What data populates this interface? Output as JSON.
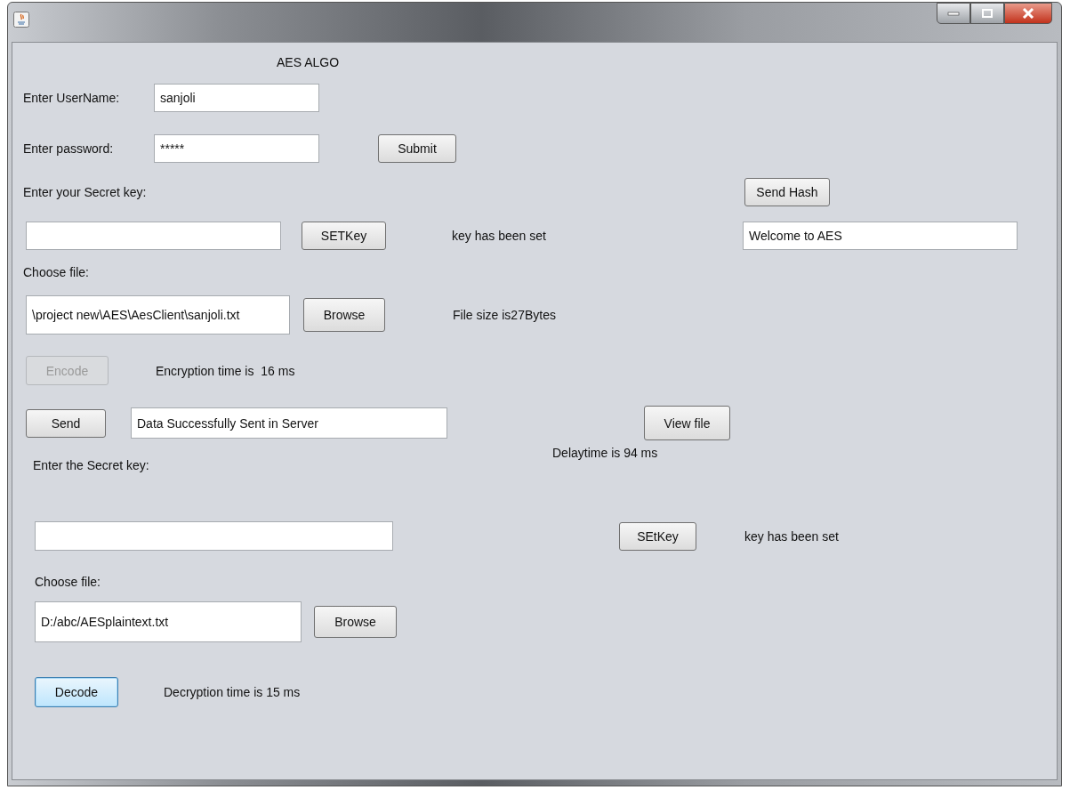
{
  "heading": "AES ALGO",
  "login": {
    "username_label": "Enter UserName:",
    "username": "sanjoli",
    "password_label": "Enter password:",
    "password": "*****",
    "submit_button": "Submit"
  },
  "encrypt": {
    "secret_key_label": "Enter your Secret key:",
    "send_hash_button": "Send Hash",
    "set_key_button": "SETKey",
    "key_status": "key has been set",
    "hash_message": "Welcome to AES",
    "choose_file_label": "Choose file:",
    "file_path": "\\project new\\AES\\AesClient\\sanjoli.txt",
    "browse_button": "Browse",
    "file_size": "File size is27Bytes",
    "encode_button": {
      "label": "Encode",
      "disabled": true
    },
    "encryption_time": "Encryption time is  16 ms",
    "send_button": "Send",
    "send_status": "Data Successfully Sent in Server",
    "view_file_button": "View file",
    "delay_time": "Delaytime is 94 ms"
  },
  "decrypt": {
    "secret_key_label": "Enter the Secret key:",
    "set_key_button": "SEtKey",
    "key_status": "key has been set",
    "choose_file_label": "Choose file:",
    "file_path": "D:/abc/AESplaintext.txt",
    "browse_button": "Browse",
    "decode_button": {
      "label": "Decode",
      "focused": true
    },
    "decryption_time": "Decryption time is 15 ms"
  }
}
